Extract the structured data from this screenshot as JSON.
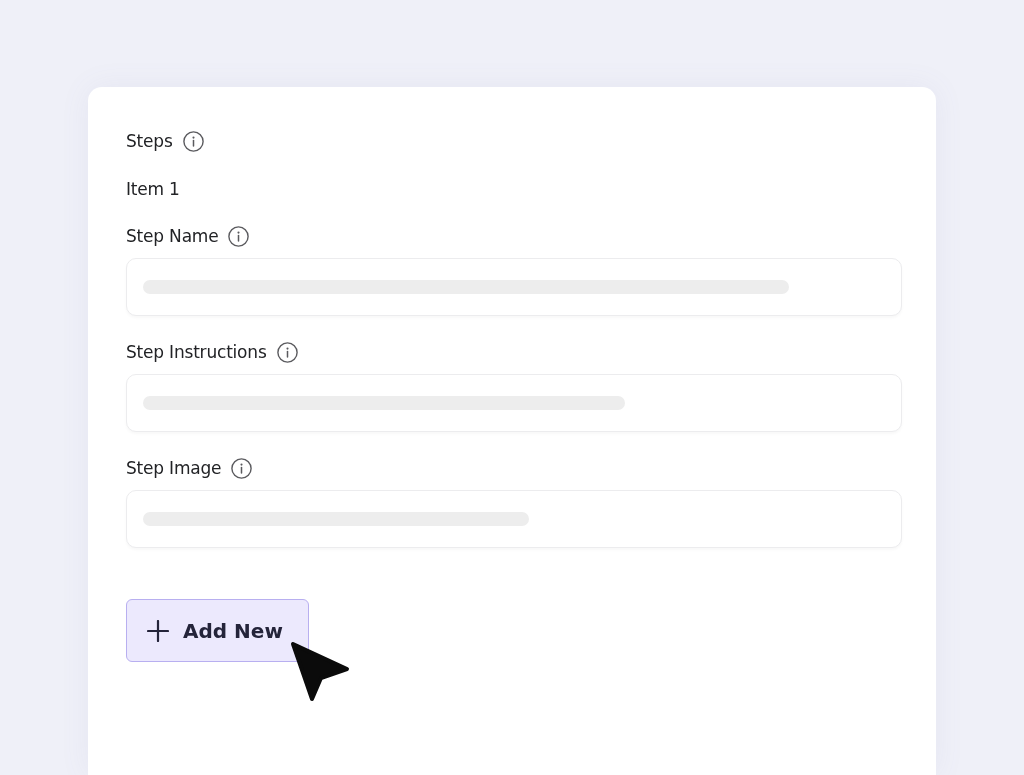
{
  "section": {
    "title": "Steps"
  },
  "item": {
    "title": "Item 1",
    "fields": [
      {
        "label": "Step Name"
      },
      {
        "label": "Step Instructions"
      },
      {
        "label": "Step Image"
      }
    ]
  },
  "add_button": {
    "label": "Add New"
  }
}
